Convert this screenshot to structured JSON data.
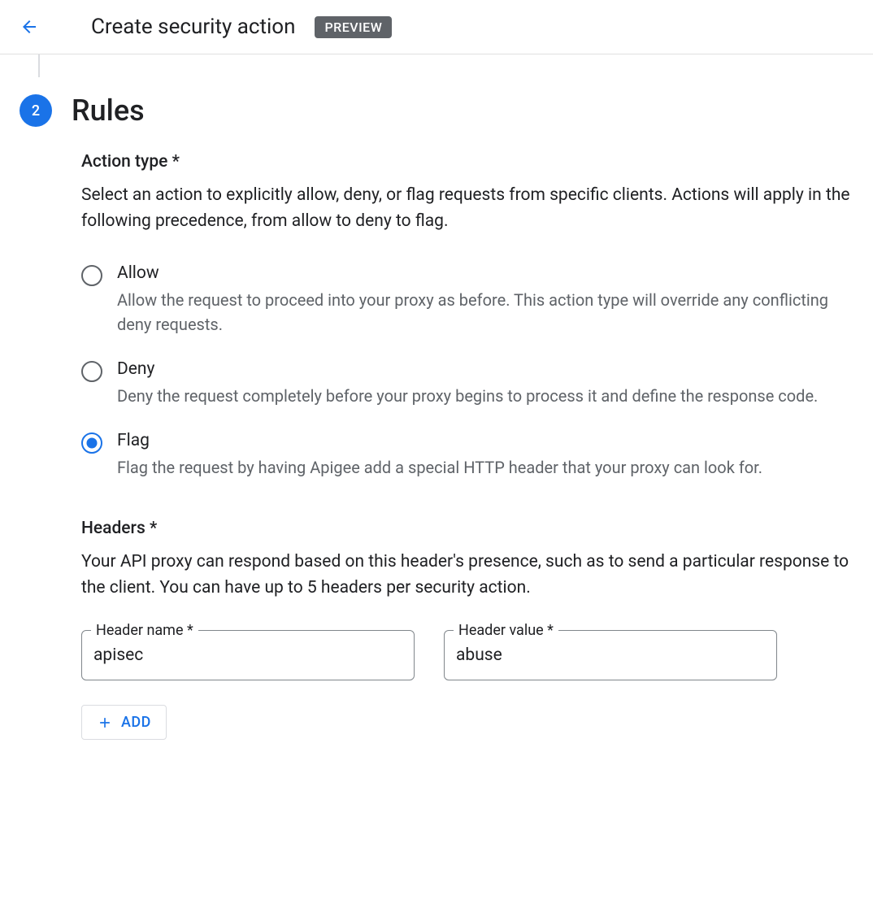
{
  "header": {
    "title": "Create security action",
    "badge": "PREVIEW"
  },
  "step": {
    "number": "2",
    "title": "Rules"
  },
  "actionType": {
    "label": "Action type *",
    "description": "Select an action to explicitly allow, deny, or flag requests from specific clients. Actions will apply in the following precedence, from allow to deny to flag.",
    "options": [
      {
        "label": "Allow",
        "description": "Allow the request to proceed into your proxy as before. This action type will override any conflicting deny requests.",
        "selected": false
      },
      {
        "label": "Deny",
        "description": "Deny the request completely before your proxy begins to process it and define the response code.",
        "selected": false
      },
      {
        "label": "Flag",
        "description": "Flag the request by having Apigee add a special HTTP header that your proxy can look for.",
        "selected": true
      }
    ]
  },
  "headers": {
    "label": "Headers *",
    "description": "Your API proxy can respond based on this header's presence, such as to send a particular response to the client. You can have up to 5 headers per security action.",
    "nameLabel": "Header name *",
    "valueLabel": "Header value *",
    "rows": [
      {
        "name": "apisec",
        "value": "abuse"
      }
    ],
    "addButton": "ADD"
  }
}
